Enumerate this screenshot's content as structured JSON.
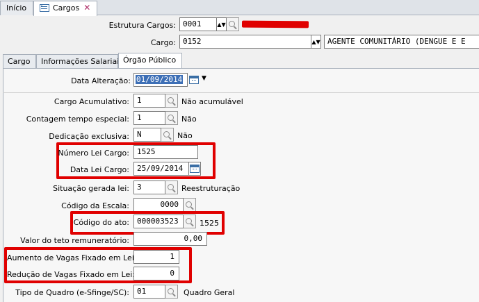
{
  "tabs": {
    "home": "Início",
    "cargos": "Cargos"
  },
  "header": {
    "estrutura_label": "Estrutura Cargos:",
    "estrutura_value": "0001",
    "cargo_label": "Cargo:",
    "cargo_value": "0152",
    "cargo_desc": "AGENTE COMUNITÁRIO (DENGUE E E"
  },
  "subtabs": {
    "cargo": "Cargo",
    "info": "Informações Salariais",
    "orgao": "Órgão Público"
  },
  "form": {
    "data_alteracao_label": "Data Alteração:",
    "data_alteracao_value": "01/09/2014",
    "cargo_acumulativo_label": "Cargo Acumulativo:",
    "cargo_acumulativo_value": "1",
    "cargo_acumulativo_desc": "Não acumulável",
    "contagem_label": "Contagem tempo especial:",
    "contagem_value": "1",
    "contagem_desc": "Não",
    "dedicacao_label": "Dedicação exclusiva:",
    "dedicacao_value": "N",
    "dedicacao_desc": "Não",
    "numero_lei_label": "Número Lei Cargo:",
    "numero_lei_value": "1525",
    "data_lei_label": "Data Lei Cargo:",
    "data_lei_value": "25/09/2014",
    "situacao_label": "Situação gerada lei:",
    "situacao_value": "3",
    "situacao_desc": "Reestruturação",
    "codigo_escala_label": "Código da Escala:",
    "codigo_escala_value": "0000",
    "codigo_ato_label": "Código do ato:",
    "codigo_ato_value": "000003523",
    "codigo_ato_desc": "1525",
    "valor_teto_label": "Valor do teto remuneratório:",
    "valor_teto_value": "0,00",
    "aumento_label": "Aumento de Vagas Fixado em Lei:",
    "aumento_value": "1",
    "reducao_label": "Redução de Vagas Fixado em Lei:",
    "reducao_value": "0",
    "tipo_quadro_label": "Tipo de Quadro (e-Sfinge/SC):",
    "tipo_quadro_value": "01",
    "tipo_quadro_desc": "Quadro Geral"
  },
  "colors": {
    "highlight": "#e00000",
    "accent": "#3a6ea5"
  }
}
